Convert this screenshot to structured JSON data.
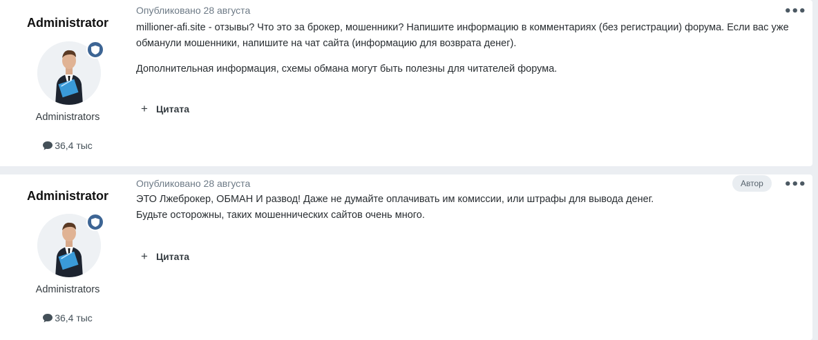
{
  "posts": [
    {
      "author": "Administrator",
      "group": "Administrators",
      "post_count": "36,4 тыс",
      "published": "Опубликовано 28 августа",
      "badge": "",
      "paragraphs": [
        "millioner-afi.site - отзывы? Что это за брокер, мошенники? Напишите информацию в комментариях (без регистрации) форума. Если вас уже обманули мошенники, напишите на чат сайта (информацию для возврата денег).",
        "Дополнительная информация, схемы обмана могут быть полезны для читателей форума."
      ],
      "quote_label": "Цитата",
      "menu_label": "•••"
    },
    {
      "author": "Administrator",
      "group": "Administrators",
      "post_count": "36,4 тыс",
      "published": "Опубликовано 28 августа",
      "badge": "Автор",
      "paragraphs": [
        "ЭТО Лжеброкер, ОБМАН И развод! Даже не думайте оплачивать им комиссии, или штрафы для вывода денег.",
        "Будьте осторожны, таких мошеннических сайтов очень много."
      ],
      "quote_label": "Цитата",
      "menu_label": "•••"
    }
  ],
  "icons": {
    "comment": "comment-icon",
    "badge": "shield-icon",
    "plus": "plus-icon"
  },
  "colors": {
    "badge_bg": "#3d6594",
    "meta_text": "#6d7a86",
    "author_badge_bg": "#e9edf1"
  }
}
